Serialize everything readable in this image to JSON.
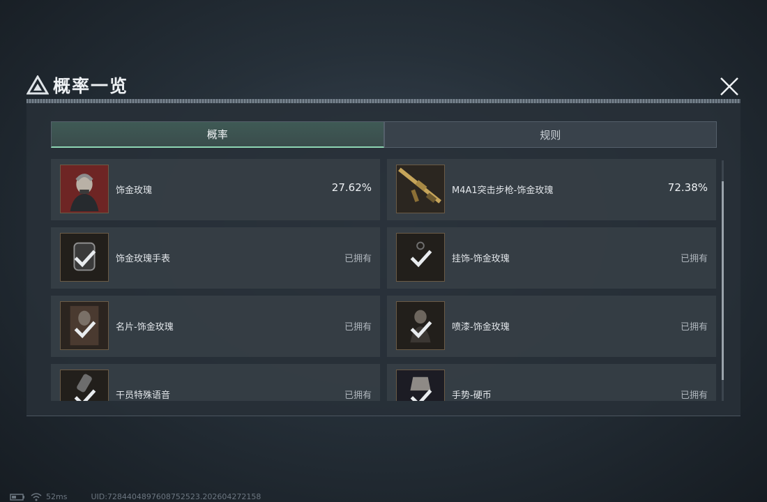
{
  "header": {
    "title": "概率一览"
  },
  "tabs": [
    {
      "label": "概率",
      "active": true
    },
    {
      "label": "规则",
      "active": false
    }
  ],
  "items": [
    {
      "name": "饰金玫瑰",
      "value": "27.62%",
      "icon": "operator-portrait"
    },
    {
      "name": "M4A1突击步枪-饰金玫瑰",
      "value": "72.38%",
      "icon": "rifle"
    },
    {
      "name": "饰金玫瑰手表",
      "status": "已拥有",
      "icon": "watch"
    },
    {
      "name": "挂饰-饰金玫瑰",
      "status": "已拥有",
      "icon": "charm"
    },
    {
      "name": "名片-饰金玫瑰",
      "status": "已拥有",
      "icon": "name-card"
    },
    {
      "name": "喷漆-饰金玫瑰",
      "status": "已拥有",
      "icon": "spray"
    },
    {
      "name": "干员特殊语音",
      "status": "已拥有",
      "icon": "voice"
    },
    {
      "name": "手势-硬币",
      "status": "已拥有",
      "icon": "gesture-coin"
    }
  ],
  "footer": {
    "ping": "52ms",
    "uid": "UID:7284404897608752523.202604272158"
  },
  "colors": {
    "accent": "#8fd6b4",
    "item_border": "#6b5b46"
  }
}
